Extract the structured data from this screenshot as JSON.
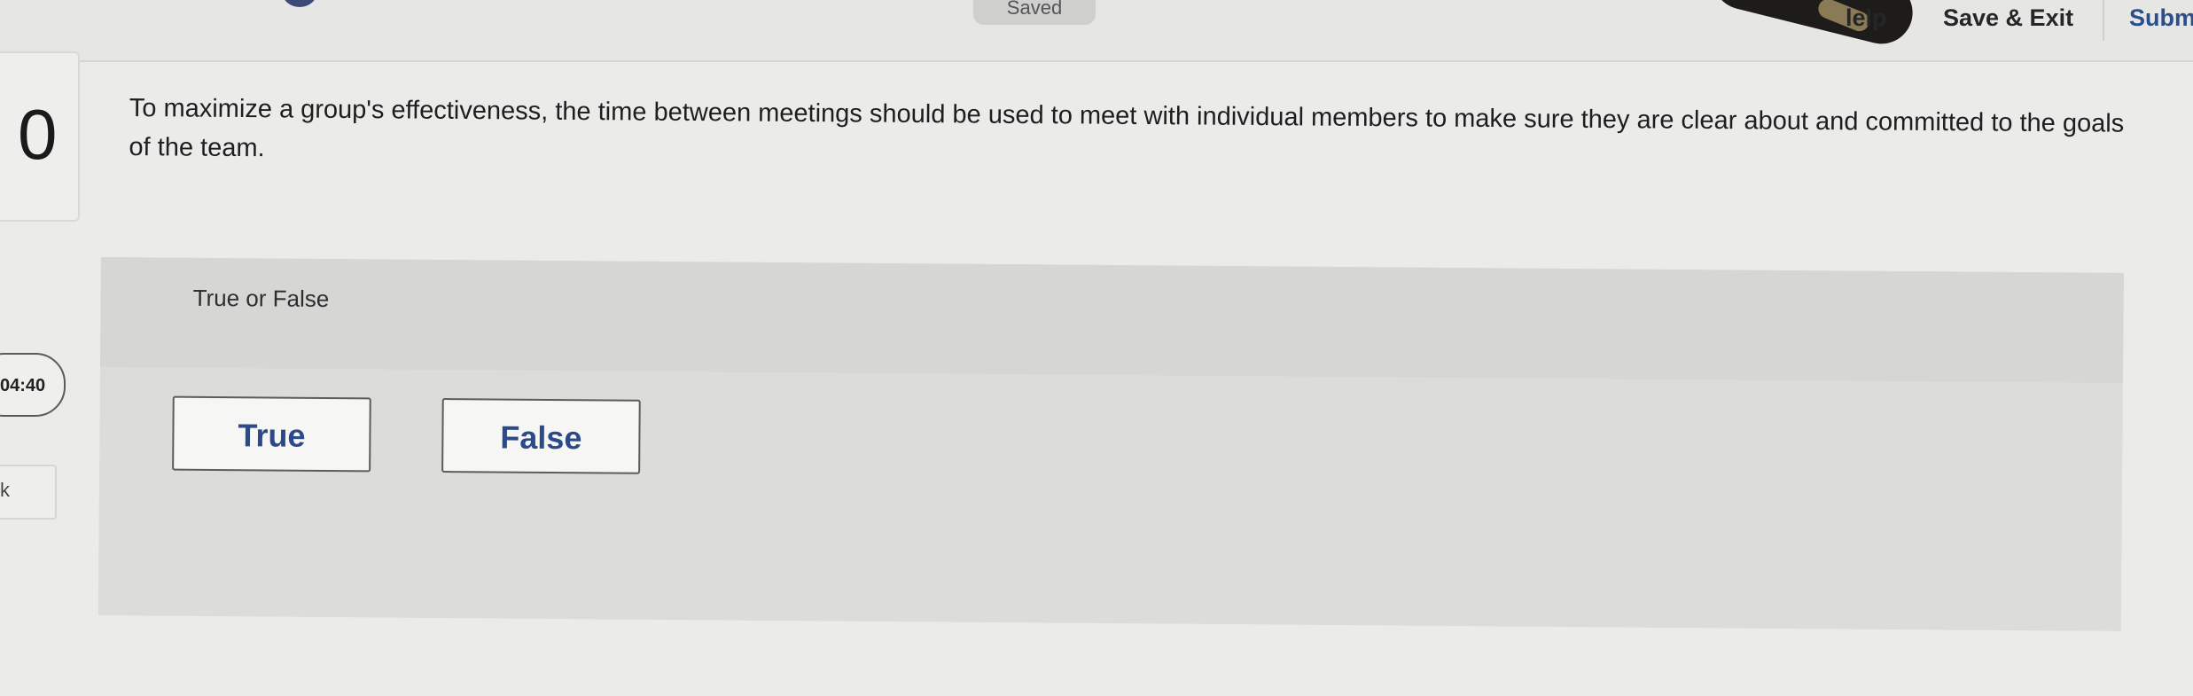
{
  "header": {
    "status": "Saved",
    "help_label": "Help",
    "help_visible": "lelp",
    "save_exit_label": "Save & Exit",
    "submit_visible": "Subm"
  },
  "sidebar": {
    "progress_value": "0",
    "timer": "04:40",
    "side_box_text": "k"
  },
  "question": {
    "text": "To maximize a group's effectiveness, the time between meetings should be used to meet with individual members to make sure they are clear about and committed to the goals of the team."
  },
  "answer": {
    "type_label": "True or False",
    "options": [
      "True",
      "False"
    ]
  },
  "colors": {
    "accent": "#2c4a8a",
    "background": "#ebebea",
    "panel": "#dcdcdb"
  }
}
